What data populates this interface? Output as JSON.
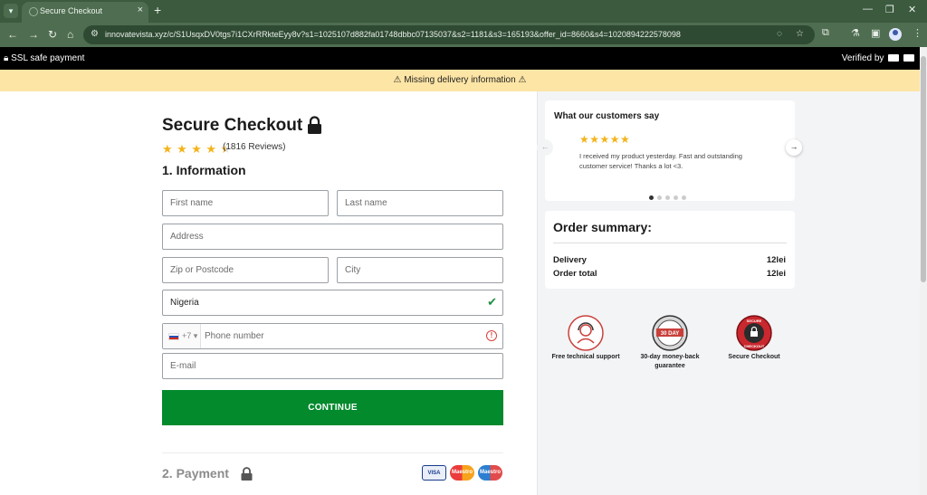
{
  "browser": {
    "tab_title": "Secure Checkout",
    "url": "innovatevista.xyz/c/S1UsqxDV0tgs7i1CXrRRkteEyy8v?s1=1025107d882fa01748dbbc07135037&s2=1181&s3=165193&offer_id=8660&s4=1020894222578098"
  },
  "top_bar": {
    "ssl_text": "SSL safe payment",
    "verified_text": "Verified by"
  },
  "warning": {
    "text": "Missing delivery information"
  },
  "checkout": {
    "title": "Secure Checkout",
    "rating": 4.5,
    "reviews": "(1816 Reviews)",
    "section1": "1. Information",
    "fields": {
      "first_name": "First name",
      "last_name": "Last name",
      "address": "Address",
      "zip": "Zip or Postcode",
      "city": "City",
      "country": "Nigeria",
      "phone_code": "+7",
      "phone": "Phone number",
      "email": "E-mail"
    },
    "continue": "CONTINUE",
    "section2": "2. Payment",
    "cards": [
      "VISA",
      "Maestro",
      "Maestro"
    ]
  },
  "testimonials": {
    "heading": "What our customers say",
    "stars": "★★★★★",
    "text": "I received my product yesterday. Fast and outstanding customer service! Thanks a lot <3.",
    "slides": 5,
    "active_slide": 0
  },
  "summary": {
    "title": "Order summary:",
    "delivery_label": "Delivery",
    "delivery_value": "12lei",
    "total_label": "Order total",
    "total_value": "12lei"
  },
  "badges": {
    "support": "Free technical support",
    "money_back": "30-day money-back guarantee",
    "money_back_seal": "30 DAY",
    "secure": "Secure Checkout",
    "secure_seal_top": "SECURE",
    "secure_seal_bottom": "CHECKOUT"
  },
  "colors": {
    "continue_green": "#028a2d",
    "star_gold": "#f3b41b",
    "warning_bg": "#fde5a5",
    "chrome_green": "#4f6d50"
  }
}
